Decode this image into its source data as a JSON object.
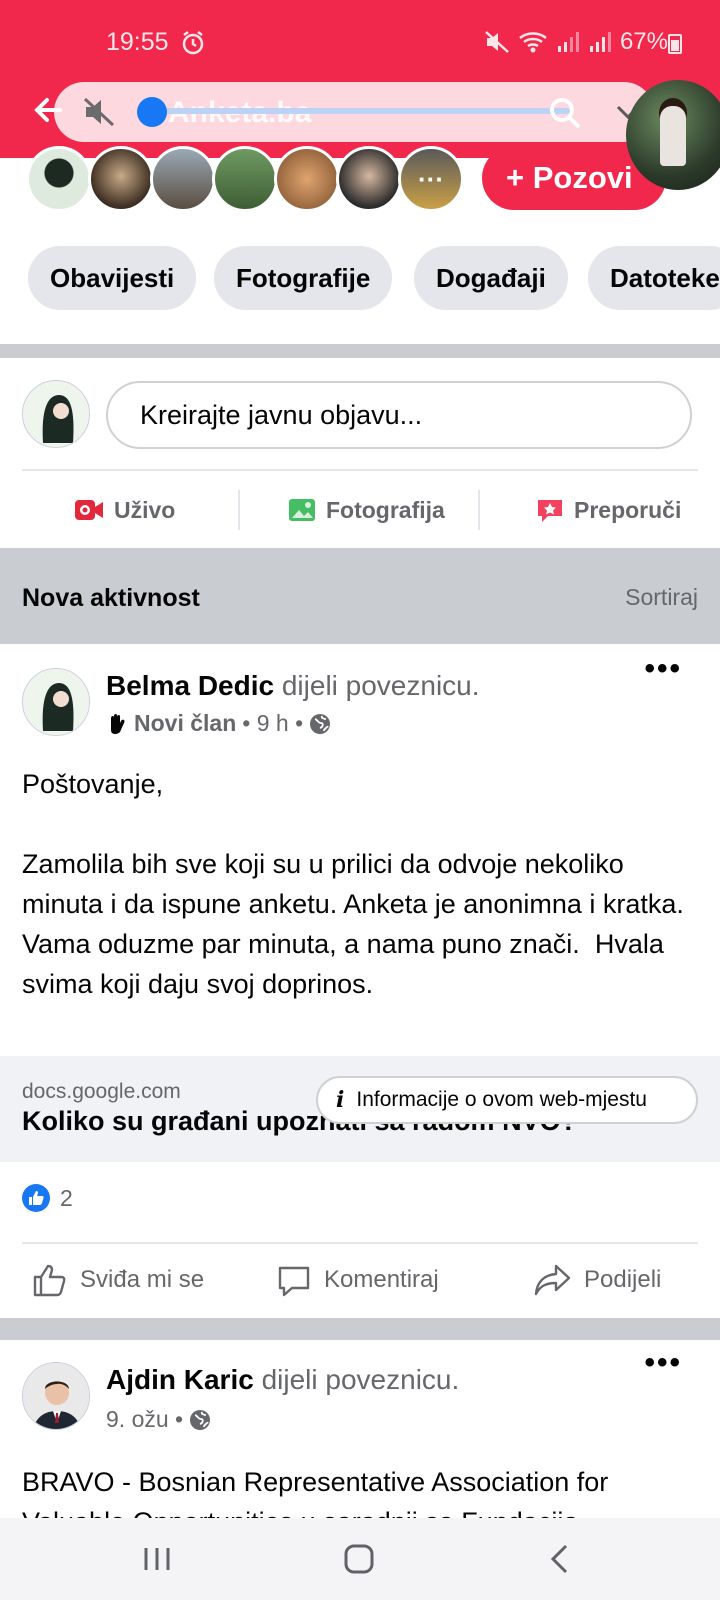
{
  "status_bar": {
    "time": "19:55",
    "battery": "67%"
  },
  "overlay": {
    "url_title": "Anketa.ba"
  },
  "group_header": {
    "invite_label": "+ Pozovi",
    "more_members_glyph": "···"
  },
  "tabs": [
    "Obavijesti",
    "Fotografije",
    "Događaji",
    "Datoteke"
  ],
  "composer": {
    "placeholder": "Kreirajte javnu objavu...",
    "actions": [
      {
        "label": "Uživo",
        "icon": "live-video-icon",
        "color": "#e4283c"
      },
      {
        "label": "Fotografija",
        "icon": "photo-icon",
        "color": "#45bd62"
      },
      {
        "label": "Preporuči",
        "icon": "recommend-icon",
        "color": "#f3425f"
      }
    ]
  },
  "activity": {
    "title": "Nova aktivnost",
    "sort_label": "Sortiraj"
  },
  "posts": [
    {
      "author": "Belma Dedic",
      "action": " dijeli poveznicu.",
      "badge": "Novi član",
      "time": "• 9 h •",
      "text": "Poštovanje,\n\nZamolila bih sve koji su u prilici da odvoje nekoliko minuta i da ispune anketu. Anketa je anonimna i kratka. Vama oduzme par minuta, a nama puno znači.  Hvala svima koji daju svoj doprinos.",
      "link_domain": "docs.google.com",
      "link_title": "Koliko su građani upoznati sa radom NVO?",
      "info_label": "Informacije o ovom web-mjestu",
      "like_count": "2",
      "buttons": [
        "Sviđa mi se",
        "Komentiraj",
        "Podijeli"
      ]
    },
    {
      "author": "Ajdin Karic",
      "action": " dijeli poveznicu.",
      "time": "9. ožu •",
      "text": "BRAVO - Bosnian Representative Association for Valuable Opportunities u saradnji sa Fundacija"
    }
  ],
  "colors": {
    "brand": "#f1284b",
    "facebook_blue": "#1877f2",
    "separator": "#c9ccd1"
  }
}
